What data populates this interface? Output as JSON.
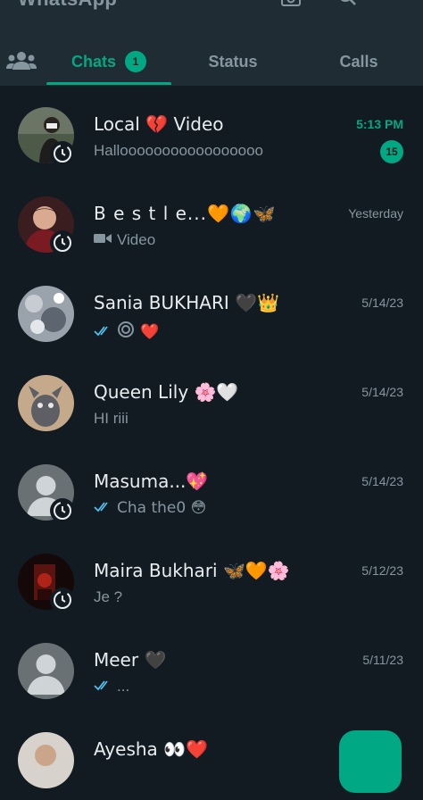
{
  "header": {
    "title": "WhatsApp",
    "icons": [
      "camera-icon",
      "search-icon",
      "more-options-icon"
    ]
  },
  "tabs": {
    "community_icon": "community-icon",
    "items": [
      {
        "label": "Chats",
        "badge": "1",
        "active": true
      },
      {
        "label": "Status",
        "active": false
      },
      {
        "label": "Calls",
        "active": false
      }
    ]
  },
  "chats": [
    {
      "name": "Local 💔 Video",
      "preview": "Hallooooooooooooooooo",
      "time": "5:13 PM",
      "unread": "15",
      "has_status": true
    },
    {
      "name": "B e s t l e...🧡🌍🦋",
      "preview": "Video",
      "preview_icon": "video-icon",
      "time": "Yesterday",
      "has_status": true
    },
    {
      "name": "Sania BUKHARI 🖤👑",
      "preview": "❤️",
      "preview_icon": "double-check-icon",
      "preview_icon2": "sticker-icon",
      "time": "5/14/23",
      "has_status": false
    },
    {
      "name": "Queen Lily 🌸🤍",
      "preview": "HI riii",
      "time": "5/14/23",
      "has_status": false
    },
    {
      "name": "Masuma...💖",
      "preview": "Cha the0 😳",
      "preview_icon": "double-check-icon",
      "time": "5/14/23",
      "has_status": true
    },
    {
      "name": "Maira Bukhari 🦋🧡🌸",
      "preview": "Je ?",
      "time": "5/12/23",
      "has_status": true
    },
    {
      "name": "Meer 🖤",
      "preview": "...",
      "preview_icon": "double-check-icon",
      "time": "5/11/23",
      "has_status": false
    },
    {
      "name": "Ayesha 👀❤️",
      "preview": "",
      "time": "",
      "has_status": false
    }
  ],
  "colors": {
    "accent": "#00a884",
    "background": "#121b22",
    "header": "#1f2c34",
    "tick_blue": "#53bdeb"
  },
  "fab": {
    "icon": "new-chat-icon"
  }
}
